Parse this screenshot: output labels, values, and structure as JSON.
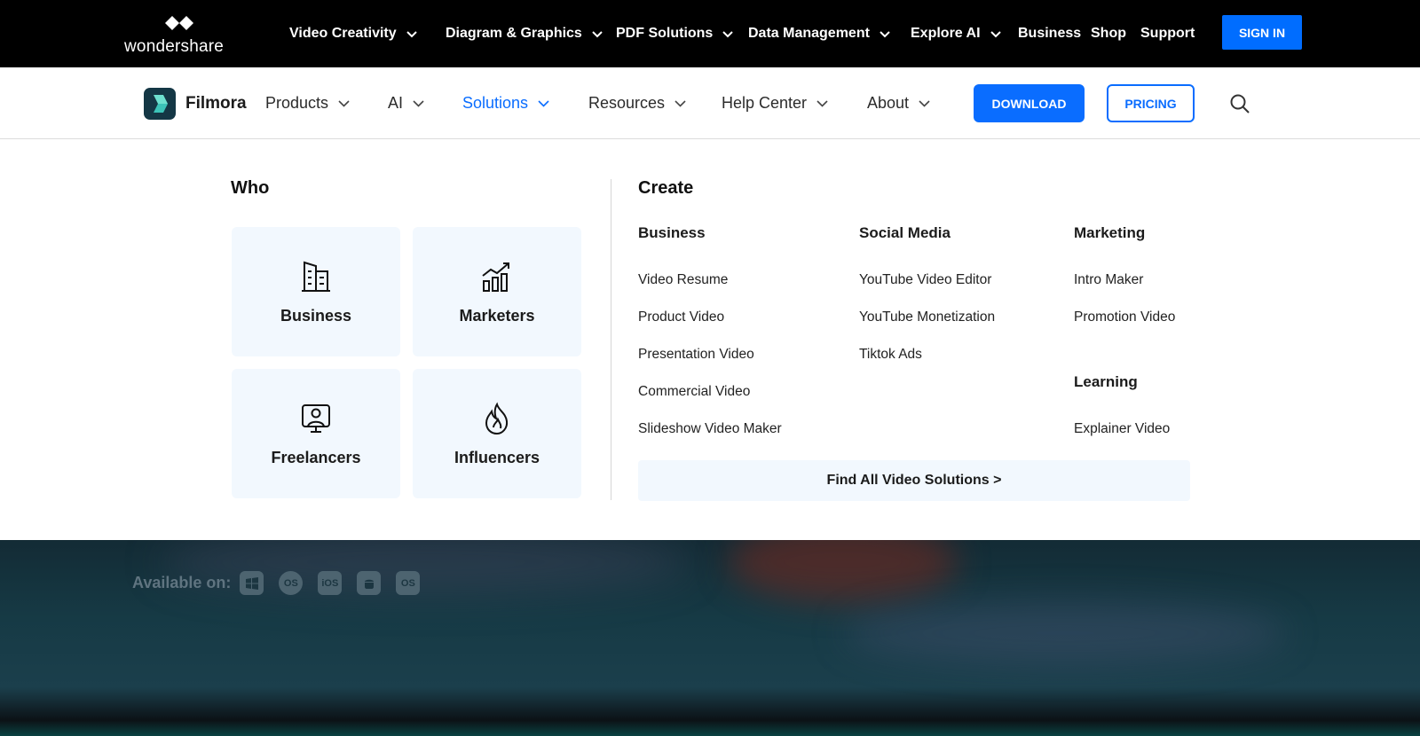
{
  "topbar": {
    "logo_text": "wondershare",
    "nav": [
      {
        "label": "Video Creativity",
        "dropdown": true
      },
      {
        "label": "Diagram & Graphics",
        "dropdown": true
      },
      {
        "label": "PDF Solutions",
        "dropdown": true
      },
      {
        "label": "Data Management",
        "dropdown": true
      },
      {
        "label": "Explore AI",
        "dropdown": true
      },
      {
        "label": "Business",
        "dropdown": false
      },
      {
        "label": "Shop",
        "dropdown": false
      },
      {
        "label": "Support",
        "dropdown": false
      }
    ],
    "signin_label": "SIGN IN"
  },
  "subnav": {
    "brand": "Filmora",
    "items": [
      {
        "label": "Products",
        "active": false
      },
      {
        "label": "AI",
        "active": false
      },
      {
        "label": "Solutions",
        "active": true
      },
      {
        "label": "Resources",
        "active": false
      },
      {
        "label": "Help Center",
        "active": false
      },
      {
        "label": "About",
        "active": false
      }
    ],
    "download_label": "DOWNLOAD",
    "pricing_label": "PRICING",
    "search_icon": "search-icon"
  },
  "mega_menu": {
    "who": {
      "title": "Who",
      "cards": [
        {
          "label": "Business",
          "icon": "building-icon"
        },
        {
          "label": "Marketers",
          "icon": "chart-growth-icon"
        },
        {
          "label": "Freelancers",
          "icon": "presenter-icon"
        },
        {
          "label": "Influencers",
          "icon": "flame-icon"
        }
      ]
    },
    "create": {
      "title": "Create",
      "columns": [
        {
          "heading": "Business",
          "links": [
            "Video Resume",
            "Product Video",
            "Presentation Video",
            "Commercial Video",
            "Slideshow Video Maker"
          ]
        },
        {
          "heading": "Social Media",
          "links": [
            "YouTube Video Editor",
            "YouTube Monetization",
            "Tiktok Ads"
          ]
        },
        {
          "heading": "Marketing",
          "links": [
            "Intro Maker",
            "Promotion Video"
          ]
        },
        {
          "heading": "Learning",
          "links": [
            "Explainer Video"
          ]
        }
      ],
      "find_all_label": "Find All Video Solutions >"
    }
  },
  "hero": {
    "available_label": "Available on:",
    "platforms": [
      "windows-icon",
      "macos-icon",
      "ios-icon",
      "android-icon",
      "ipados-icon"
    ],
    "platform_texts": [
      "OS",
      "iOS",
      "OS"
    ]
  },
  "colors": {
    "accent": "#0a6dff",
    "topbar_bg": "#000000",
    "card_bg": "#f2f8fe"
  }
}
